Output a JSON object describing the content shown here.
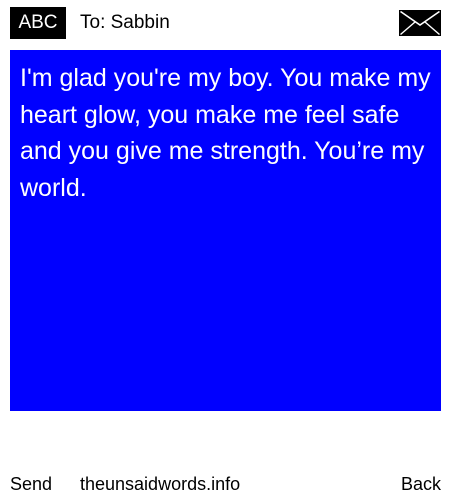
{
  "header": {
    "mode_label": "ABC",
    "recipient": "To: Sabbin",
    "envelope_icon": "envelope-icon"
  },
  "message": {
    "text": "I'm glad you're my boy. You make my heart glow, you make me feel safe and you give me strength. You’re my world.",
    "background_color": "#0000ff",
    "text_color": "#ffffff"
  },
  "footer": {
    "send_label": "Send",
    "site_label": "theunsaidwords.info",
    "back_label": "Back"
  }
}
